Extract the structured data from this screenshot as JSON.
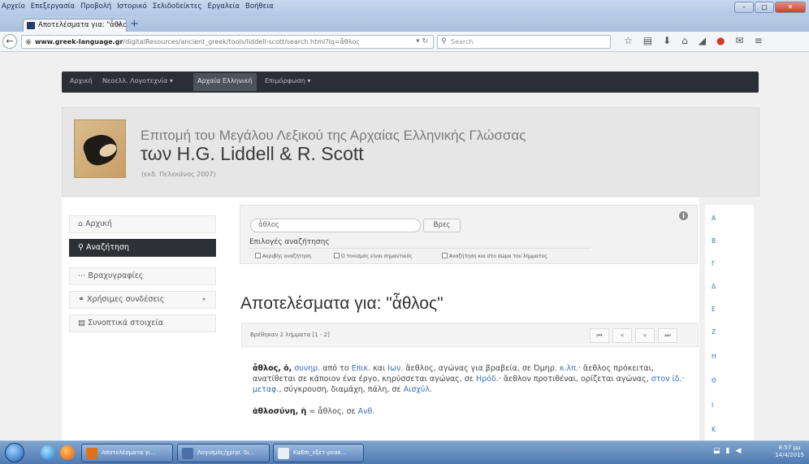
{
  "menubar": [
    "Αρχείο",
    "Επεξεργασία",
    "Προβολή",
    "Ιστορικό",
    "Σελιδοδείκτες",
    "Εργαλεία",
    "Βοήθεια"
  ],
  "window_buttons": [
    "–",
    "□",
    "✕"
  ],
  "tab": {
    "title": "Αποτελέσματα για: \"ἆθλος\"",
    "close": "×"
  },
  "new_tab": "+",
  "url": {
    "domain": "www.greek-language.gr",
    "path": "/digitalResources/ancient_greek/tools/liddell-scott/search.html?lq=ἆθλος"
  },
  "search_placeholder": "Search",
  "site_nav": {
    "items": [
      "Αρχική",
      "Νεοελλ. Λογοτεχνία",
      "Αρχαία Ελληνική",
      "Επιμόρφωση"
    ],
    "dropdown_mark": "▾"
  },
  "header": {
    "title_line1": "Επιτομή του Μεγάλου Λεξικού της Αρχαίας Ελληνικής Γλώσσας",
    "title_line2": "των H.G. Liddell & R. Scott",
    "subtitle": "(εκδ. Πελεκάνος 2007)"
  },
  "sidebar": [
    {
      "label": "Αρχική",
      "icon": "home-icon",
      "glyph": "⌂"
    },
    {
      "label": "Αναζήτηση",
      "icon": "search-icon",
      "glyph": "⚲"
    },
    {
      "label": "Βραχυγραφίες",
      "icon": "ellipsis-icon",
      "glyph": "⋯"
    },
    {
      "label": "Χρήσιμες συνδέσεις",
      "icon": "link-icon",
      "glyph": "⚭"
    },
    {
      "label": "Συνοπτικά στοιχεία",
      "icon": "info-list-icon",
      "glyph": "▤"
    }
  ],
  "search": {
    "value": "ἆθλος",
    "button": "Βρες",
    "options_label": "Επιλογές αναζήτησης",
    "checkboxes": [
      "Ακριβής αναζήτηση",
      "Ο τονισμός είναι σημαντικός",
      "Αναζήτηση και στο σώμα του λήμματος"
    ],
    "info_glyph": "i"
  },
  "results": {
    "heading": "Αποτελέσματα για: \"ἆθλος\"",
    "count": "Βρέθηκαν 2 λήμματα [1 - 2]",
    "pager": [
      "⏮",
      "«",
      "»",
      "⏭"
    ]
  },
  "entry1": {
    "lemma": "ἆθλος, ὁ,",
    "t1": " ",
    "l1": "συνηρ.",
    "t2": " από το ",
    "l2": "Επικ.",
    "t3": " και ",
    "l3": "Ιων.",
    "t4": " ἄεθλος, αγώνας για βραβεία, σε Όμηρ. ",
    "l4": "κ.λπ.",
    "t5": "· ἄεθλος πρόκειται, ανατίθεται σε κάποιον ένα έργο, κηρύσσεται αγώνας, σε ",
    "l5": "Ηρόδ.",
    "t6": "· ἄεθλον προτιθέναι, ορίζεται αγώνας, ",
    "l6": "στον ίδ.",
    "t7": "· ",
    "l7": "μεταφ.",
    "t8": ", σύγκρουση, διαμάχη, πάλη, σε ",
    "l8": "Αισχύλ."
  },
  "entry2": {
    "lemma": "ἀθλοσύνη, ἡ",
    "t1": " = ἆθλος, σε ",
    "l1": "Ανθ."
  },
  "alphabet": [
    "Α",
    "Β",
    "Γ",
    "Δ",
    "Ε",
    "Ζ",
    "Η",
    "Θ",
    "Ι",
    "Κ"
  ],
  "taskbar": {
    "buttons": [
      "Αποτελέσματα γι...",
      "Λογισμός/χρησ. δι...",
      "ΚαΕπι_εξετ-ρεακ..."
    ],
    "time": "8:57 μμ",
    "date": "14/4/2015"
  }
}
